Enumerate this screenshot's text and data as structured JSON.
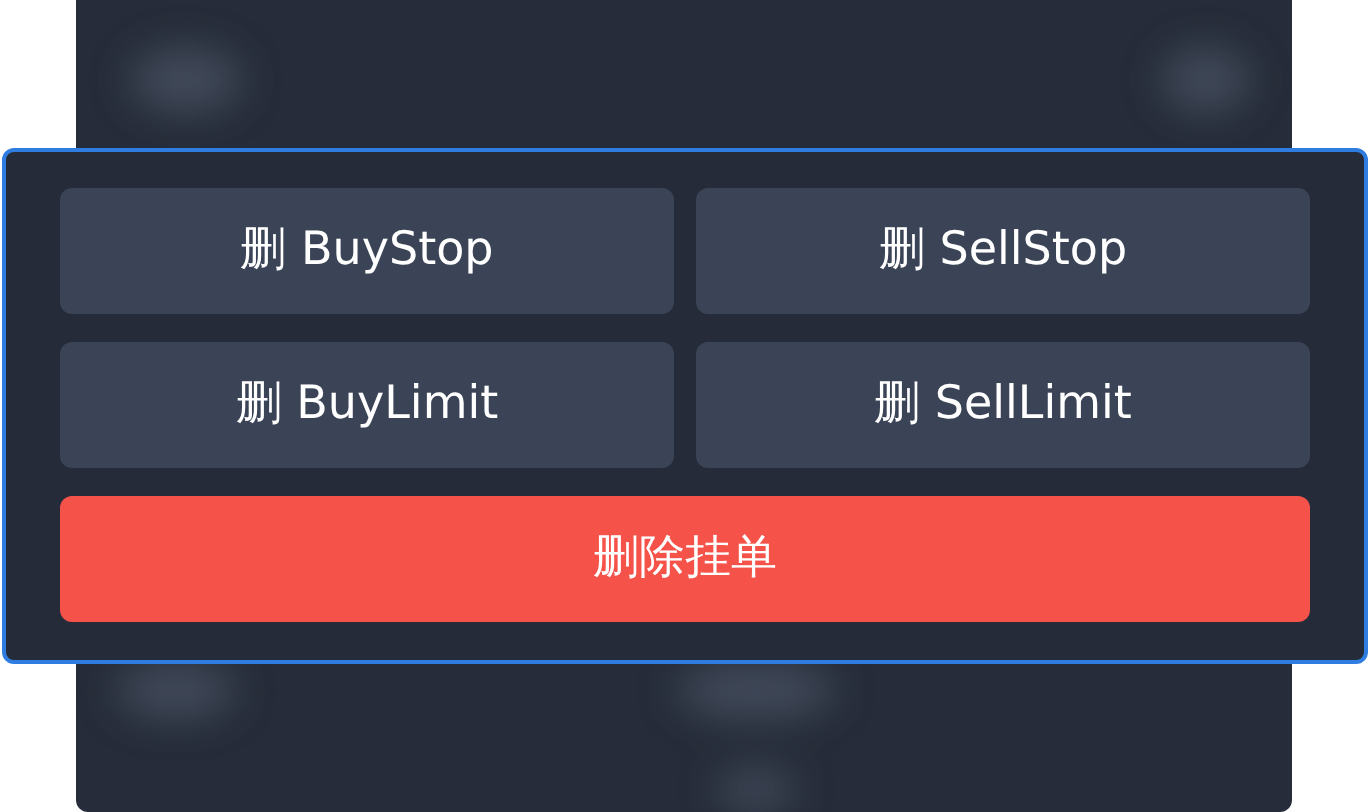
{
  "buttons": [
    {
      "label": "删 BuyStop"
    },
    {
      "label": "删 SellStop"
    },
    {
      "label": "删 BuyLimit"
    },
    {
      "label": "删 SellLimit"
    }
  ],
  "delete_button": {
    "label": "删除挂单"
  }
}
